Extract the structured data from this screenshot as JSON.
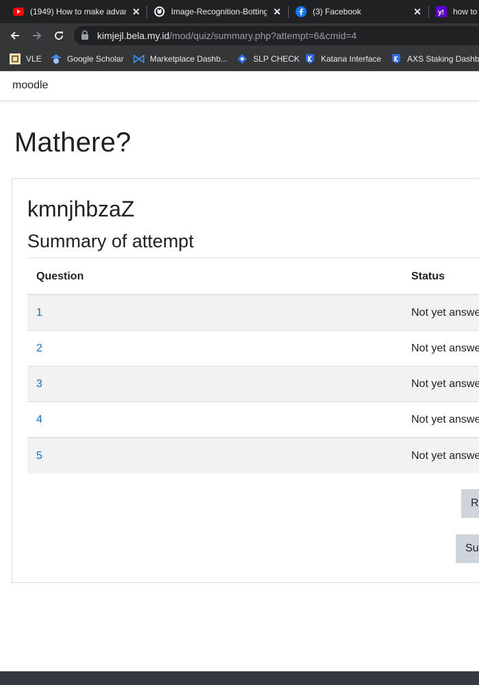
{
  "browser": {
    "tabs": [
      {
        "title": "(1949) How to make advan",
        "icon": "youtube-icon"
      },
      {
        "title": "Image-Recognition-Botting",
        "icon": "github-icon"
      },
      {
        "title": "(3) Facebook",
        "icon": "facebook-icon"
      },
      {
        "title": "how to",
        "icon": "yahoo-icon"
      }
    ],
    "url_host": "kimjejl.bela.my.id",
    "url_path": "/mod/quiz/summary.php?attempt=6&cmid=4",
    "bookmarks": [
      {
        "label": "VLE",
        "icon": "vle-icon"
      },
      {
        "label": "Google Scholar",
        "icon": "google-scholar-icon"
      },
      {
        "label": "Marketplace Dashb...",
        "icon": "marketplace-icon"
      },
      {
        "label": "SLP CHECK",
        "icon": "slp-icon"
      },
      {
        "label": "Katana Interface",
        "icon": "katana-icon"
      },
      {
        "label": "AXS Staking Dashb...",
        "icon": "axs-icon"
      }
    ]
  },
  "site": {
    "name": "moodle"
  },
  "page": {
    "title": "Mathere?",
    "quiz_name": "kmnjhbzaZ",
    "summary_heading": "Summary of attempt",
    "table": {
      "headers": {
        "question": "Question",
        "status": "Status"
      },
      "rows": [
        {
          "question": "1",
          "status": "Not yet answe"
        },
        {
          "question": "2",
          "status": "Not yet answe"
        },
        {
          "question": "3",
          "status": "Not yet answe"
        },
        {
          "question": "4",
          "status": "Not yet answe"
        },
        {
          "question": "5",
          "status": "Not yet answe"
        }
      ]
    },
    "buttons": {
      "return": "Re",
      "submit": "Sul"
    }
  },
  "colors": {
    "link": "#0f6cbf",
    "button": "#ced4da",
    "chrome_dark": "#202124",
    "chrome_toolbar": "#35363a"
  }
}
